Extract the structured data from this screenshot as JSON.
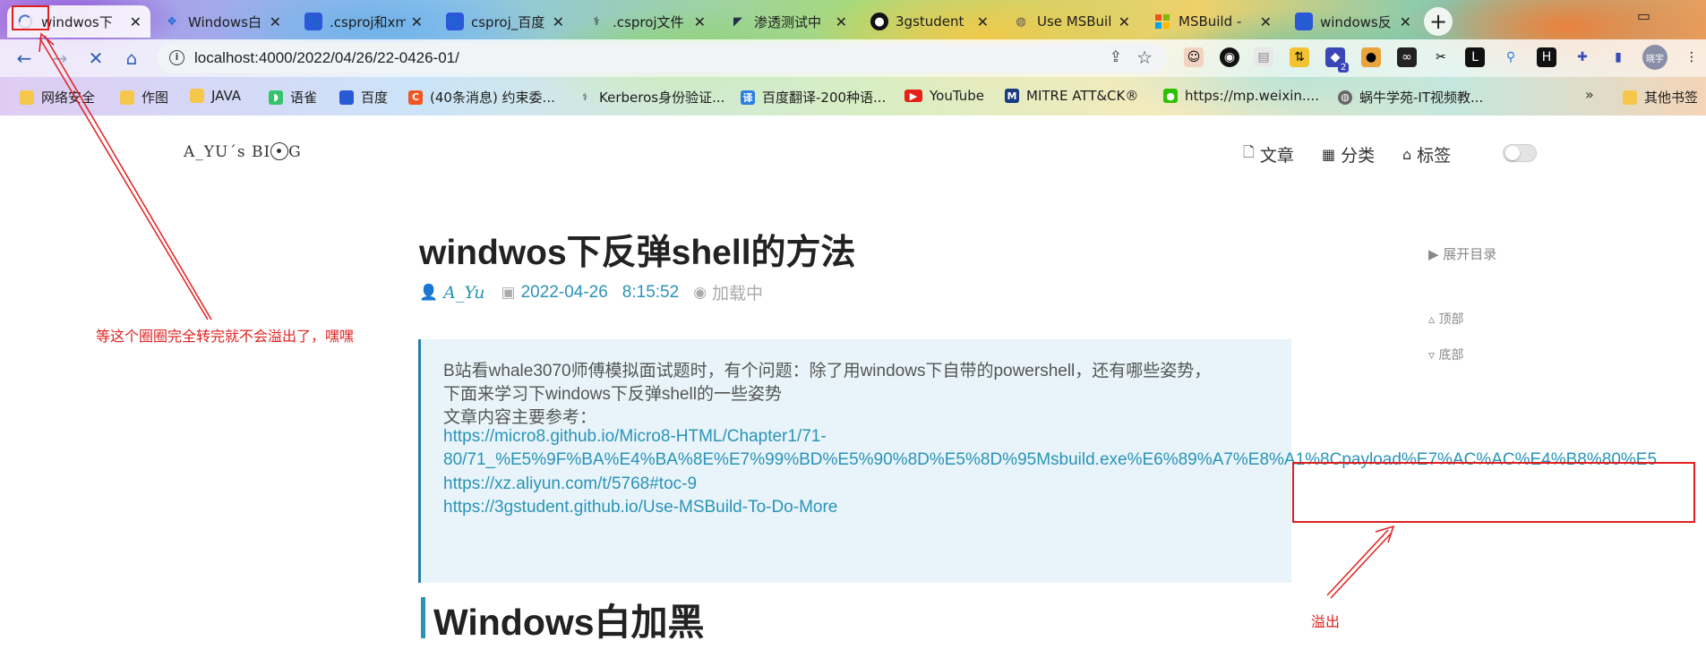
{
  "tabs": [
    {
      "title": "windwos下",
      "active": true
    },
    {
      "title": "Windows白",
      "active": false
    },
    {
      "title": ".csproj和xm",
      "active": false
    },
    {
      "title": "csproj_百度",
      "active": false
    },
    {
      "title": ".csproj文件",
      "active": false
    },
    {
      "title": "渗透测试中",
      "active": false
    },
    {
      "title": "3gstudent",
      "active": false
    },
    {
      "title": "Use MSBuil",
      "active": false
    },
    {
      "title": "MSBuild -",
      "active": false
    },
    {
      "title": "windows反",
      "active": false
    }
  ],
  "newtab_label": "+",
  "toolbar": {
    "url": "localhost:4000/2022/04/26/22-0426-01/",
    "profile_initials": "晓宇",
    "ext_badge": "2"
  },
  "bookmarks": [
    {
      "label": "网络安全",
      "icon": "folder-icon"
    },
    {
      "label": "作图",
      "icon": "folder-icon"
    },
    {
      "label": "JAVA",
      "icon": "folder-icon"
    },
    {
      "label": "语雀",
      "icon": "yuque-icon"
    },
    {
      "label": "百度",
      "icon": "baidu-icon"
    },
    {
      "label": "(40条消息) 约束委...",
      "icon": "csdn-icon"
    },
    {
      "label": "Kerberos身份验证...",
      "icon": "kerberos-icon"
    },
    {
      "label": "百度翻译-200种语...",
      "icon": "translate-icon"
    },
    {
      "label": "YouTube",
      "icon": "youtube-icon"
    },
    {
      "label": "MITRE ATT&CK®",
      "icon": "mitre-icon"
    },
    {
      "label": "https://mp.weixin....",
      "icon": "wechat-icon"
    },
    {
      "label": "蜗牛学苑-IT视频教...",
      "icon": "globe-icon"
    },
    {
      "label": "其他书签",
      "icon": "folder-icon"
    }
  ],
  "site": {
    "logo": "A_YU´s BI",
    "logo_tail": "G",
    "nav": [
      {
        "label": "文章",
        "icon": "document-icon"
      },
      {
        "label": "分类",
        "icon": "grid-icon"
      },
      {
        "label": "标签",
        "icon": "tag-icon"
      }
    ]
  },
  "post": {
    "title": "windwos下反弹shell的方法",
    "author": "A_Yu",
    "date": "2022-04-26",
    "time": "8:15:52",
    "views": "加载中",
    "quote_lines": [
      "B站看whale3070师傅模拟面试题时，有个问题：除了用windows下自带的powershell，还有哪些姿势，",
      "下面来学习下windows下反弹shell的一些姿势",
      "文章内容主要参考："
    ],
    "links": [
      "https://micro8.github.io/Micro8-HTML/Chapter1/71-",
      "80/71_%E5%9F%BA%E4%BA%8E%E7%99%BD%E5%90%8D%E5%8D%95Msbuild.exe%E6%89%A7%E8%A1%8Cpayload%E7%AC%AC%E4%B8%80%E5",
      "https://xz.aliyun.com/t/5768#toc-9",
      "https://3gstudent.github.io/Use-MSBuild-To-Do-More"
    ],
    "h2": "Windows白加黑"
  },
  "toc": {
    "toggle": "▶ 展开目录",
    "top": "顶部",
    "bottom": "底部"
  },
  "annotations": {
    "spinner_note": "等这个圈圈完全转完就不会溢出了，嘿嘿",
    "overflow_note": "溢出",
    "color": "#e02020"
  }
}
